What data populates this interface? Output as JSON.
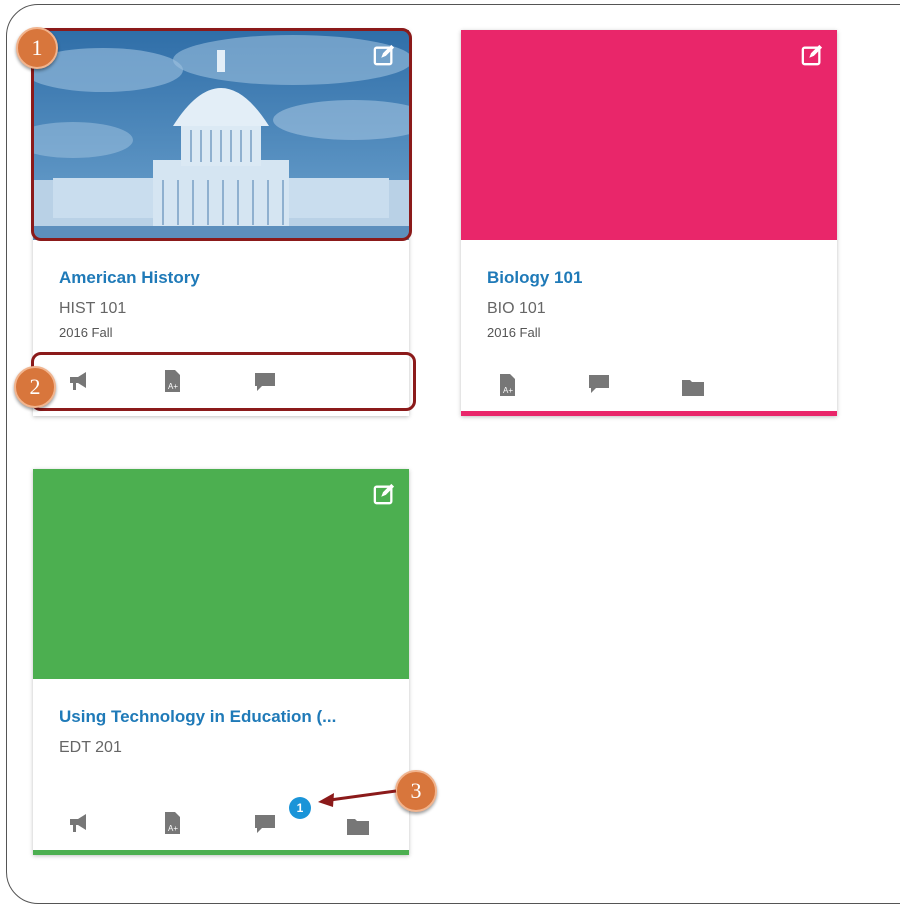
{
  "cards": [
    {
      "title": "American History",
      "code": "HIST 101",
      "term": "2016 Fall",
      "color": "#2f7fb8",
      "hero": "capitol-building-image",
      "actions": [
        "announcements-icon",
        "assignments-icon",
        "discussions-icon"
      ]
    },
    {
      "title": "Biology 101",
      "code": "BIO 101",
      "term": "2016 Fall",
      "color": "#e9266a",
      "actions": [
        "assignments-icon",
        "discussions-icon",
        "files-icon"
      ]
    },
    {
      "title": "Using Technology in Education (...",
      "code": "EDT 201",
      "color": "#4caf50",
      "unread_discussions": "1",
      "actions": [
        "announcements-icon",
        "assignments-icon",
        "discussions-icon",
        "files-icon"
      ]
    }
  ],
  "callouts": [
    "1",
    "2",
    "3"
  ],
  "colors": {
    "annotation_box": "#8b1a1a",
    "callout": "#d8763c",
    "badge": "#1a94d8",
    "link": "#1f7ab8"
  }
}
